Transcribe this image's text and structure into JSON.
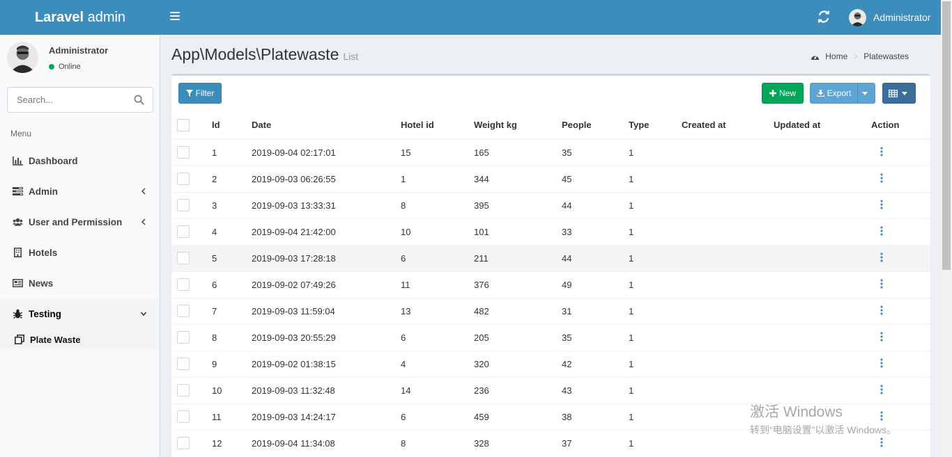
{
  "header": {
    "logo_bold": "Laravel",
    "logo_rest": " admin",
    "user_name": "Administrator",
    "accent": "#3c8dbc"
  },
  "sidebar": {
    "user_name": "Administrator",
    "status": "Online",
    "search_placeholder": "Search...",
    "menu_header": "Menu",
    "items": [
      {
        "label": "Dashboard",
        "icon": "bar-chart-icon"
      },
      {
        "label": "Admin",
        "icon": "tasks-icon"
      },
      {
        "label": "User and Permission",
        "icon": "users-icon"
      },
      {
        "label": "Hotels",
        "icon": "building-icon"
      },
      {
        "label": "News",
        "icon": "newspaper-icon"
      },
      {
        "label": "Testing",
        "icon": "bug-icon"
      }
    ],
    "sub_items": [
      {
        "label": "Plate Waste",
        "icon": "clone-icon"
      }
    ]
  },
  "page": {
    "title": "App\\Models\\Platewaste",
    "subtitle": "List",
    "breadcrumb": {
      "home": "Home",
      "current": "Platewastes"
    }
  },
  "toolbar": {
    "filter": "Filter",
    "new": "New",
    "export": "Export"
  },
  "table": {
    "columns": [
      "Id",
      "Date",
      "Hotel id",
      "Weight kg",
      "People",
      "Type",
      "Created at",
      "Updated at",
      "Action"
    ],
    "rows": [
      {
        "id": "1",
        "date": "2019-09-04 02:17:01",
        "hotel_id": "15",
        "weight": "165",
        "people": "35",
        "type": "1",
        "created": "",
        "updated": ""
      },
      {
        "id": "2",
        "date": "2019-09-03 06:26:55",
        "hotel_id": "1",
        "weight": "344",
        "people": "45",
        "type": "1",
        "created": "",
        "updated": ""
      },
      {
        "id": "3",
        "date": "2019-09-03 13:33:31",
        "hotel_id": "8",
        "weight": "395",
        "people": "44",
        "type": "1",
        "created": "",
        "updated": ""
      },
      {
        "id": "4",
        "date": "2019-09-04 21:42:00",
        "hotel_id": "10",
        "weight": "101",
        "people": "33",
        "type": "1",
        "created": "",
        "updated": ""
      },
      {
        "id": "5",
        "date": "2019-09-03 17:28:18",
        "hotel_id": "6",
        "weight": "211",
        "people": "44",
        "type": "1",
        "created": "",
        "updated": ""
      },
      {
        "id": "6",
        "date": "2019-09-02 07:49:26",
        "hotel_id": "11",
        "weight": "376",
        "people": "49",
        "type": "1",
        "created": "",
        "updated": ""
      },
      {
        "id": "7",
        "date": "2019-09-03 11:59:04",
        "hotel_id": "13",
        "weight": "482",
        "people": "31",
        "type": "1",
        "created": "",
        "updated": ""
      },
      {
        "id": "8",
        "date": "2019-09-03 20:55:29",
        "hotel_id": "6",
        "weight": "205",
        "people": "35",
        "type": "1",
        "created": "",
        "updated": ""
      },
      {
        "id": "9",
        "date": "2019-09-02 01:38:15",
        "hotel_id": "4",
        "weight": "320",
        "people": "42",
        "type": "1",
        "created": "",
        "updated": ""
      },
      {
        "id": "10",
        "date": "2019-09-03 11:32:48",
        "hotel_id": "14",
        "weight": "236",
        "people": "43",
        "type": "1",
        "created": "",
        "updated": ""
      },
      {
        "id": "11",
        "date": "2019-09-03 14:24:17",
        "hotel_id": "6",
        "weight": "459",
        "people": "38",
        "type": "1",
        "created": "",
        "updated": ""
      },
      {
        "id": "12",
        "date": "2019-09-04 11:34:08",
        "hotel_id": "8",
        "weight": "328",
        "people": "37",
        "type": "1",
        "created": "",
        "updated": ""
      }
    ]
  },
  "watermark": {
    "line1": "激活 Windows",
    "line2": "转到“电脑设置”以激活 Windows。"
  }
}
